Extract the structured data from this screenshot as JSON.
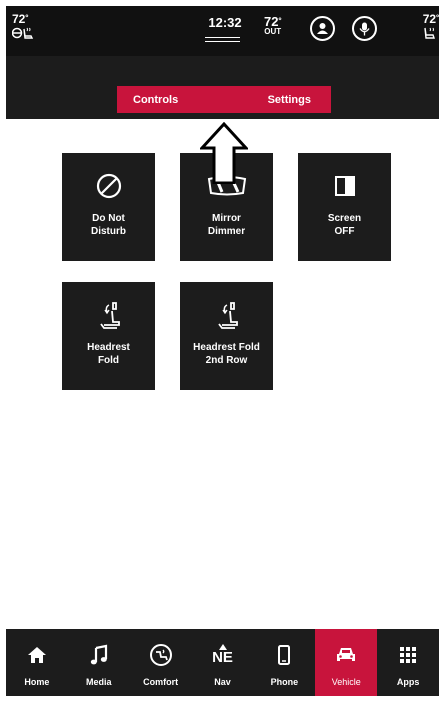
{
  "status_bar": {
    "driver_temp": "72",
    "clock": "12:32",
    "outside_temp": "72",
    "outside_label": "OUT",
    "passenger_temp": "72",
    "degree": "º"
  },
  "tabs": {
    "controls": "Controls",
    "settings": "Settings"
  },
  "tiles": [
    {
      "label": "Do Not\nDisturb",
      "icon": "do-not-disturb-icon"
    },
    {
      "label": "Mirror\nDimmer",
      "icon": "mirror-dimmer-icon"
    },
    {
      "label": "Screen\nOFF",
      "icon": "screen-off-icon"
    },
    {
      "label": "Headrest\nFold",
      "icon": "headrest-fold-icon"
    },
    {
      "label": "Headrest Fold\n2nd Row",
      "icon": "headrest-fold-2nd-row-icon"
    }
  ],
  "nav": [
    {
      "label": "Home",
      "icon": "home-icon"
    },
    {
      "label": "Media",
      "icon": "music-note-icon"
    },
    {
      "label": "Comfort",
      "icon": "comfort-icon"
    },
    {
      "label": "Nav",
      "icon": "compass-icon",
      "heading": "NE"
    },
    {
      "label": "Phone",
      "icon": "phone-icon"
    },
    {
      "label": "Vehicle",
      "icon": "car-icon",
      "active": true
    },
    {
      "label": "Apps",
      "icon": "apps-grid-icon"
    }
  ],
  "colors": {
    "accent": "#c8143c",
    "dark": "#1c1c1c",
    "statusbar": "#111111"
  }
}
